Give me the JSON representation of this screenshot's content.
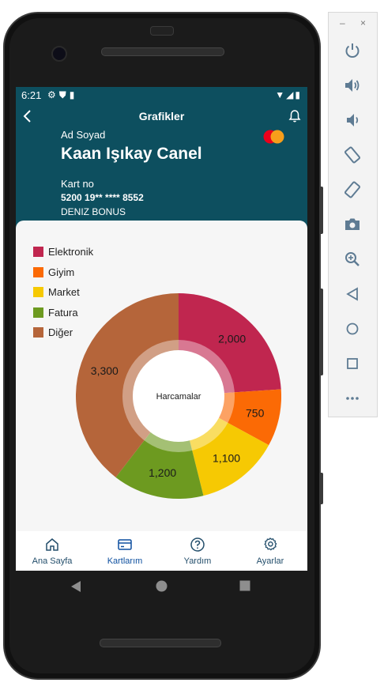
{
  "status_bar": {
    "time": "6:21"
  },
  "header": {
    "title": "Grafikler",
    "name_label": "Ad Soyad",
    "name": "Kaan Işıkay Canel",
    "card_no_label": "Kart no",
    "card_no": "5200 19** **** 8552",
    "card_type": "DENIZ BONUS"
  },
  "colors": {
    "header_bg": "#0d4f5f",
    "mastercard_red": "#eb001b",
    "mastercard_yellow": "#f79e1b"
  },
  "chart_data": {
    "type": "pie",
    "center_label": "Harcamalar",
    "legend_position": "top-left",
    "series": [
      {
        "name": "Elektronik",
        "value": 2000,
        "label": "2,000",
        "color": "#c0264f"
      },
      {
        "name": "Giyim",
        "value": 750,
        "label": "750",
        "color": "#fb6a05"
      },
      {
        "name": "Market",
        "value": 1100,
        "label": "1,100",
        "color": "#f6c903"
      },
      {
        "name": "Fatura",
        "value": 1200,
        "label": "1,200",
        "color": "#6d9a20"
      },
      {
        "name": "Diğer",
        "value": 3300,
        "label": "3,300",
        "color": "#b5653a"
      }
    ]
  },
  "bottom_nav": [
    {
      "label": "Ana Sayfa",
      "icon": "home-icon"
    },
    {
      "label": "Kartlarım",
      "icon": "card-icon"
    },
    {
      "label": "Yardım",
      "icon": "help-icon"
    },
    {
      "label": "Ayarlar",
      "icon": "settings-icon"
    }
  ],
  "emulator_panel": {
    "minimize": "–",
    "close": "×",
    "tools": [
      "power-icon",
      "volume-up-icon",
      "volume-down-icon",
      "rotate-left-icon",
      "rotate-right-icon",
      "camera-icon",
      "zoom-icon",
      "back-icon",
      "home-icon",
      "overview-icon",
      "more-icon"
    ]
  }
}
